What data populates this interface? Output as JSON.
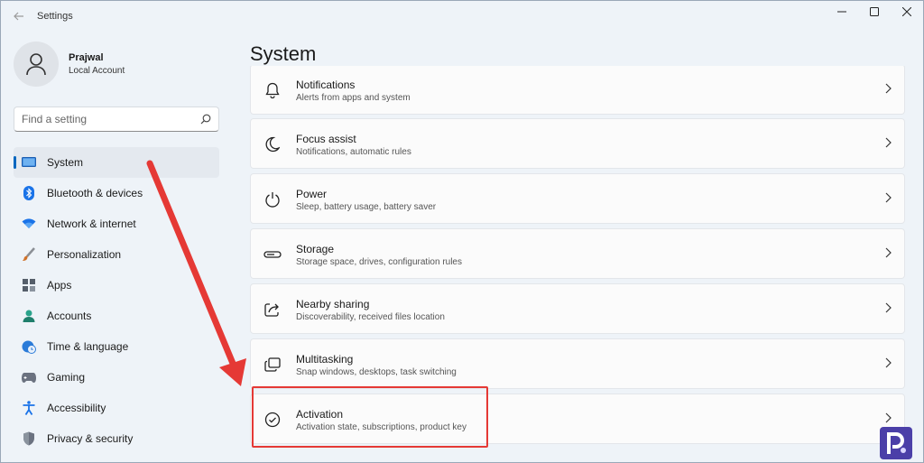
{
  "window": {
    "title": "Settings",
    "back_icon": "back-arrow-icon",
    "controls": [
      "minimize-icon",
      "maximize-icon",
      "close-icon"
    ]
  },
  "profile": {
    "name": "Prajwal",
    "subtitle": "Local Account",
    "icon": "user-avatar-icon"
  },
  "search": {
    "placeholder": "Find a setting",
    "icon": "search-icon"
  },
  "sidebar": {
    "selected": "System",
    "accent": "#0067c0",
    "items": [
      {
        "label": "System",
        "icon": "monitor-icon",
        "color": "#2b7bd8"
      },
      {
        "label": "Bluetooth & devices",
        "icon": "bluetooth-icon",
        "color": "#1a73e8"
      },
      {
        "label": "Network & internet",
        "icon": "wifi-icon",
        "color": "#1a73e8"
      },
      {
        "label": "Personalization",
        "icon": "paintbrush-icon",
        "color": "#d0722a"
      },
      {
        "label": "Apps",
        "icon": "apps-grid-icon",
        "color": "#555e6a"
      },
      {
        "label": "Accounts",
        "icon": "person-icon",
        "color": "#2aa38b"
      },
      {
        "label": "Time & language",
        "icon": "globe-clock-icon",
        "color": "#2b7bd8"
      },
      {
        "label": "Gaming",
        "icon": "gamepad-icon",
        "color": "#6b7280"
      },
      {
        "label": "Accessibility",
        "icon": "accessibility-icon",
        "color": "#1a73e8"
      },
      {
        "label": "Privacy & security",
        "icon": "shield-icon",
        "color": "#6b7280"
      }
    ]
  },
  "main": {
    "title": "System",
    "items": [
      {
        "title": "Notifications",
        "subtitle": "Alerts from apps and system",
        "icon": "bell-icon"
      },
      {
        "title": "Focus assist",
        "subtitle": "Notifications, automatic rules",
        "icon": "moon-icon"
      },
      {
        "title": "Power",
        "subtitle": "Sleep, battery usage, battery saver",
        "icon": "power-icon"
      },
      {
        "title": "Storage",
        "subtitle": "Storage space, drives, configuration rules",
        "icon": "storage-drive-icon"
      },
      {
        "title": "Nearby sharing",
        "subtitle": "Discoverability, received files location",
        "icon": "share-icon"
      },
      {
        "title": "Multitasking",
        "subtitle": "Snap windows, desktops, task switching",
        "icon": "multitask-windows-icon"
      },
      {
        "title": "Activation",
        "subtitle": "Activation state, subscriptions, product key",
        "icon": "check-circle-icon"
      }
    ]
  },
  "annotation": {
    "highlight_color": "#e53935",
    "highlighted_item": "Activation"
  }
}
